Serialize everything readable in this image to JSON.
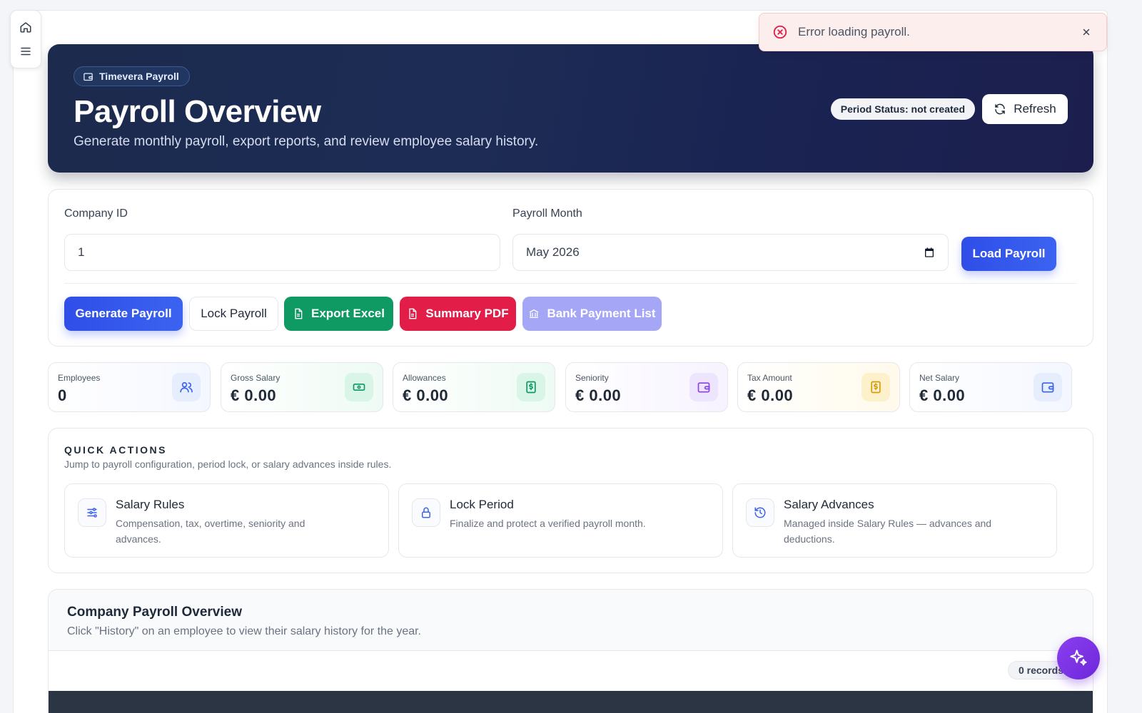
{
  "toast": {
    "message": "Error loading payroll."
  },
  "hero": {
    "brand": "Timevera Payroll",
    "title": "Payroll Overview",
    "subtitle": "Generate monthly payroll, export reports, and review employee salary history.",
    "status": "Period Status: not created",
    "refresh_label": "Refresh"
  },
  "filters": {
    "company_label": "Company ID",
    "company_value": "1",
    "month_label": "Payroll Month",
    "month_value": "May 2026",
    "load_label": "Load Payroll"
  },
  "actions": {
    "generate": "Generate Payroll",
    "lock": "Lock Payroll",
    "export_excel": "Export Excel",
    "summary_pdf": "Summary PDF",
    "bank_list": "Bank Payment List"
  },
  "stats": [
    {
      "label": "Employees",
      "value": "0",
      "icon": "users-icon",
      "color": "#3b63f0"
    },
    {
      "label": "Gross Salary",
      "value": "€ 0.00",
      "icon": "cash-icon",
      "color": "#0f9a63"
    },
    {
      "label": "Allowances",
      "value": "€ 0.00",
      "icon": "dollar-doc-icon",
      "color": "#0f9a63"
    },
    {
      "label": "Seniority",
      "value": "€ 0.00",
      "icon": "wallet-icon",
      "color": "#8b3ff0"
    },
    {
      "label": "Tax Amount",
      "value": "€ 0.00",
      "icon": "tax-doc-icon",
      "color": "#d99a0b"
    },
    {
      "label": "Net Salary",
      "value": "€ 0.00",
      "icon": "wallet-blue-icon",
      "color": "#3b63f0"
    }
  ],
  "quick": {
    "title": "QUICK ACTIONS",
    "subtitle": "Jump to payroll configuration, period lock, or salary advances inside rules.",
    "items": [
      {
        "title": "Salary Rules",
        "desc": "Compensation, tax, overtime, seniority and advances."
      },
      {
        "title": "Lock Period",
        "desc": "Finalize and protect a verified payroll month."
      },
      {
        "title": "Salary Advances",
        "desc": "Managed inside Salary Rules — advances and deductions."
      }
    ]
  },
  "overview": {
    "title": "Company Payroll Overview",
    "subtitle": "Click \"History\" on an employee to view their salary history for the year.",
    "records": "0 records"
  }
}
